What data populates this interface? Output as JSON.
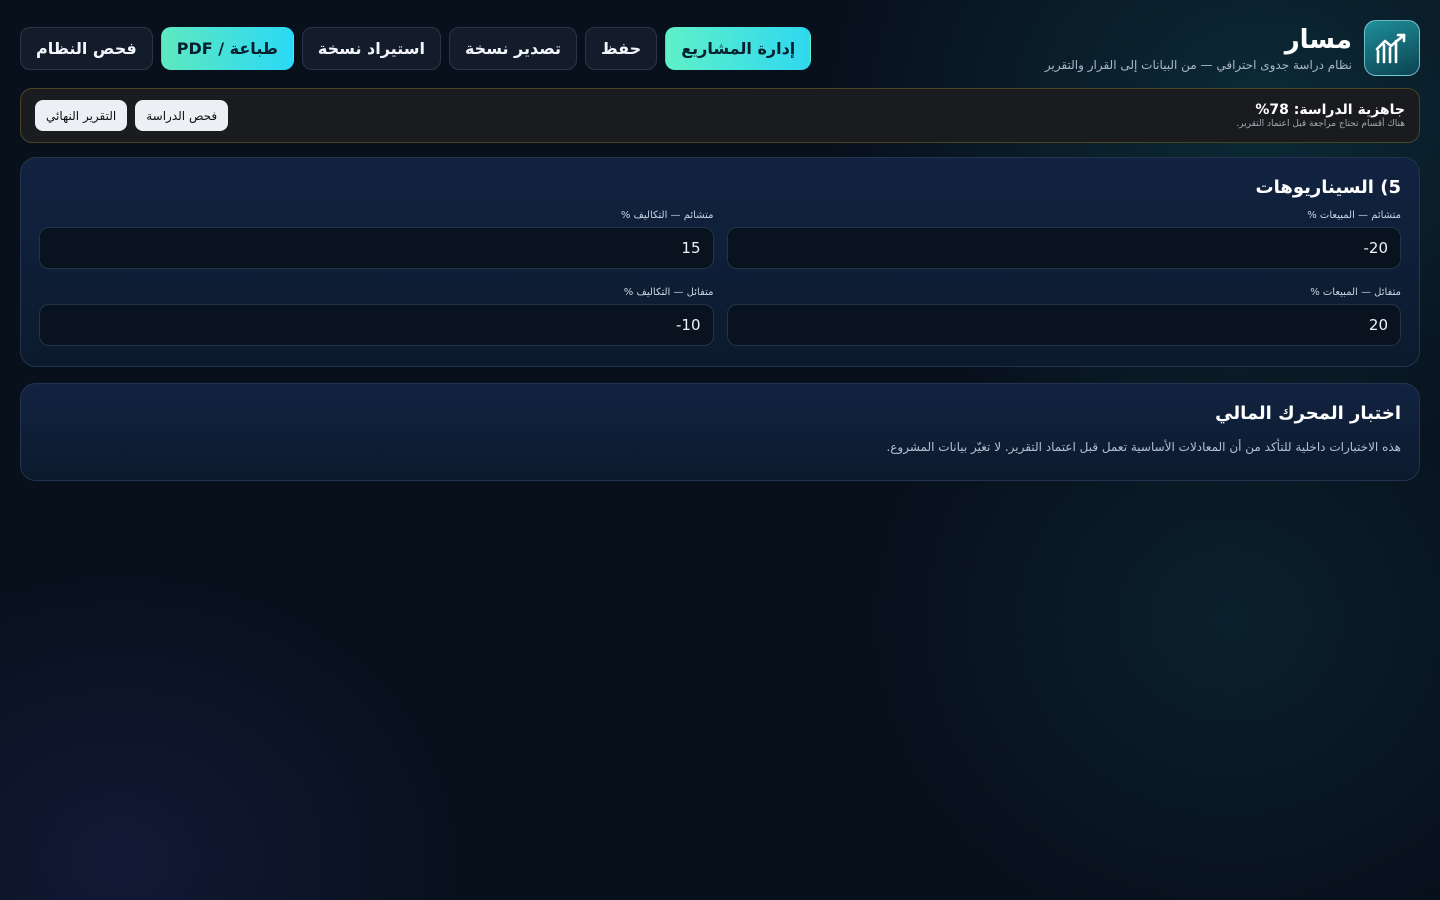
{
  "app": {
    "name": "مسار",
    "subtitle": "نظام دراسة جدوى احترافي — من البيانات إلى القرار والتقرير",
    "logo_icon": "rising-chart-icon"
  },
  "toolbar": {
    "projects": "إدارة المشاريع",
    "save": "حفظ",
    "export": "تصدير نسخة",
    "import": "استيراد نسخة",
    "print": "طباعة / PDF",
    "system_check": "فحص النظام"
  },
  "readiness": {
    "title": "جاهزية الدراسة: 78%",
    "note": "هناك أقسام تحتاج مراجعة قبل اعتماد التقرير.",
    "check_study": "فحص الدراسة",
    "final_report": "التقرير النهائي"
  },
  "scenarios": {
    "title": "5) السيناريوهات",
    "fields": {
      "pess_sales": {
        "label": "متشائم — المبيعات %",
        "value": "-20"
      },
      "pess_costs": {
        "label": "متشائم — التكاليف %",
        "value": "15"
      },
      "opt_sales": {
        "label": "متفائل — المبيعات %",
        "value": "20"
      },
      "opt_costs": {
        "label": "متفائل — التكاليف %",
        "value": "-10"
      }
    }
  },
  "engine_test": {
    "title": "اختبار المحرك المالي",
    "description": "هذه الاختبارات داخلية للتأكد من أن المعادلات الأساسية تعمل قبل اعتماد التقرير. لا تغيّر بيانات المشروع."
  }
}
